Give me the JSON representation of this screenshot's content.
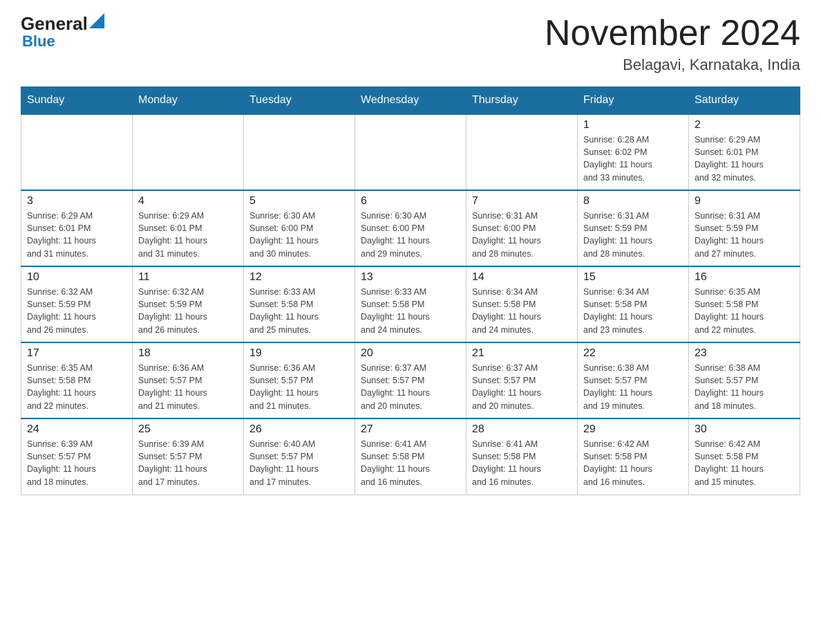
{
  "logo": {
    "general": "General",
    "blue": "Blue",
    "triangle_symbol": "▲"
  },
  "header": {
    "month_title": "November 2024",
    "location": "Belagavi, Karnataka, India"
  },
  "weekdays": [
    "Sunday",
    "Monday",
    "Tuesday",
    "Wednesday",
    "Thursday",
    "Friday",
    "Saturday"
  ],
  "weeks": [
    [
      {
        "day": "",
        "info": ""
      },
      {
        "day": "",
        "info": ""
      },
      {
        "day": "",
        "info": ""
      },
      {
        "day": "",
        "info": ""
      },
      {
        "day": "",
        "info": ""
      },
      {
        "day": "1",
        "info": "Sunrise: 6:28 AM\nSunset: 6:02 PM\nDaylight: 11 hours\nand 33 minutes."
      },
      {
        "day": "2",
        "info": "Sunrise: 6:29 AM\nSunset: 6:01 PM\nDaylight: 11 hours\nand 32 minutes."
      }
    ],
    [
      {
        "day": "3",
        "info": "Sunrise: 6:29 AM\nSunset: 6:01 PM\nDaylight: 11 hours\nand 31 minutes."
      },
      {
        "day": "4",
        "info": "Sunrise: 6:29 AM\nSunset: 6:01 PM\nDaylight: 11 hours\nand 31 minutes."
      },
      {
        "day": "5",
        "info": "Sunrise: 6:30 AM\nSunset: 6:00 PM\nDaylight: 11 hours\nand 30 minutes."
      },
      {
        "day": "6",
        "info": "Sunrise: 6:30 AM\nSunset: 6:00 PM\nDaylight: 11 hours\nand 29 minutes."
      },
      {
        "day": "7",
        "info": "Sunrise: 6:31 AM\nSunset: 6:00 PM\nDaylight: 11 hours\nand 28 minutes."
      },
      {
        "day": "8",
        "info": "Sunrise: 6:31 AM\nSunset: 5:59 PM\nDaylight: 11 hours\nand 28 minutes."
      },
      {
        "day": "9",
        "info": "Sunrise: 6:31 AM\nSunset: 5:59 PM\nDaylight: 11 hours\nand 27 minutes."
      }
    ],
    [
      {
        "day": "10",
        "info": "Sunrise: 6:32 AM\nSunset: 5:59 PM\nDaylight: 11 hours\nand 26 minutes."
      },
      {
        "day": "11",
        "info": "Sunrise: 6:32 AM\nSunset: 5:59 PM\nDaylight: 11 hours\nand 26 minutes."
      },
      {
        "day": "12",
        "info": "Sunrise: 6:33 AM\nSunset: 5:58 PM\nDaylight: 11 hours\nand 25 minutes."
      },
      {
        "day": "13",
        "info": "Sunrise: 6:33 AM\nSunset: 5:58 PM\nDaylight: 11 hours\nand 24 minutes."
      },
      {
        "day": "14",
        "info": "Sunrise: 6:34 AM\nSunset: 5:58 PM\nDaylight: 11 hours\nand 24 minutes."
      },
      {
        "day": "15",
        "info": "Sunrise: 6:34 AM\nSunset: 5:58 PM\nDaylight: 11 hours\nand 23 minutes."
      },
      {
        "day": "16",
        "info": "Sunrise: 6:35 AM\nSunset: 5:58 PM\nDaylight: 11 hours\nand 22 minutes."
      }
    ],
    [
      {
        "day": "17",
        "info": "Sunrise: 6:35 AM\nSunset: 5:58 PM\nDaylight: 11 hours\nand 22 minutes."
      },
      {
        "day": "18",
        "info": "Sunrise: 6:36 AM\nSunset: 5:57 PM\nDaylight: 11 hours\nand 21 minutes."
      },
      {
        "day": "19",
        "info": "Sunrise: 6:36 AM\nSunset: 5:57 PM\nDaylight: 11 hours\nand 21 minutes."
      },
      {
        "day": "20",
        "info": "Sunrise: 6:37 AM\nSunset: 5:57 PM\nDaylight: 11 hours\nand 20 minutes."
      },
      {
        "day": "21",
        "info": "Sunrise: 6:37 AM\nSunset: 5:57 PM\nDaylight: 11 hours\nand 20 minutes."
      },
      {
        "day": "22",
        "info": "Sunrise: 6:38 AM\nSunset: 5:57 PM\nDaylight: 11 hours\nand 19 minutes."
      },
      {
        "day": "23",
        "info": "Sunrise: 6:38 AM\nSunset: 5:57 PM\nDaylight: 11 hours\nand 18 minutes."
      }
    ],
    [
      {
        "day": "24",
        "info": "Sunrise: 6:39 AM\nSunset: 5:57 PM\nDaylight: 11 hours\nand 18 minutes."
      },
      {
        "day": "25",
        "info": "Sunrise: 6:39 AM\nSunset: 5:57 PM\nDaylight: 11 hours\nand 17 minutes."
      },
      {
        "day": "26",
        "info": "Sunrise: 6:40 AM\nSunset: 5:57 PM\nDaylight: 11 hours\nand 17 minutes."
      },
      {
        "day": "27",
        "info": "Sunrise: 6:41 AM\nSunset: 5:58 PM\nDaylight: 11 hours\nand 16 minutes."
      },
      {
        "day": "28",
        "info": "Sunrise: 6:41 AM\nSunset: 5:58 PM\nDaylight: 11 hours\nand 16 minutes."
      },
      {
        "day": "29",
        "info": "Sunrise: 6:42 AM\nSunset: 5:58 PM\nDaylight: 11 hours\nand 16 minutes."
      },
      {
        "day": "30",
        "info": "Sunrise: 6:42 AM\nSunset: 5:58 PM\nDaylight: 11 hours\nand 15 minutes."
      }
    ]
  ]
}
